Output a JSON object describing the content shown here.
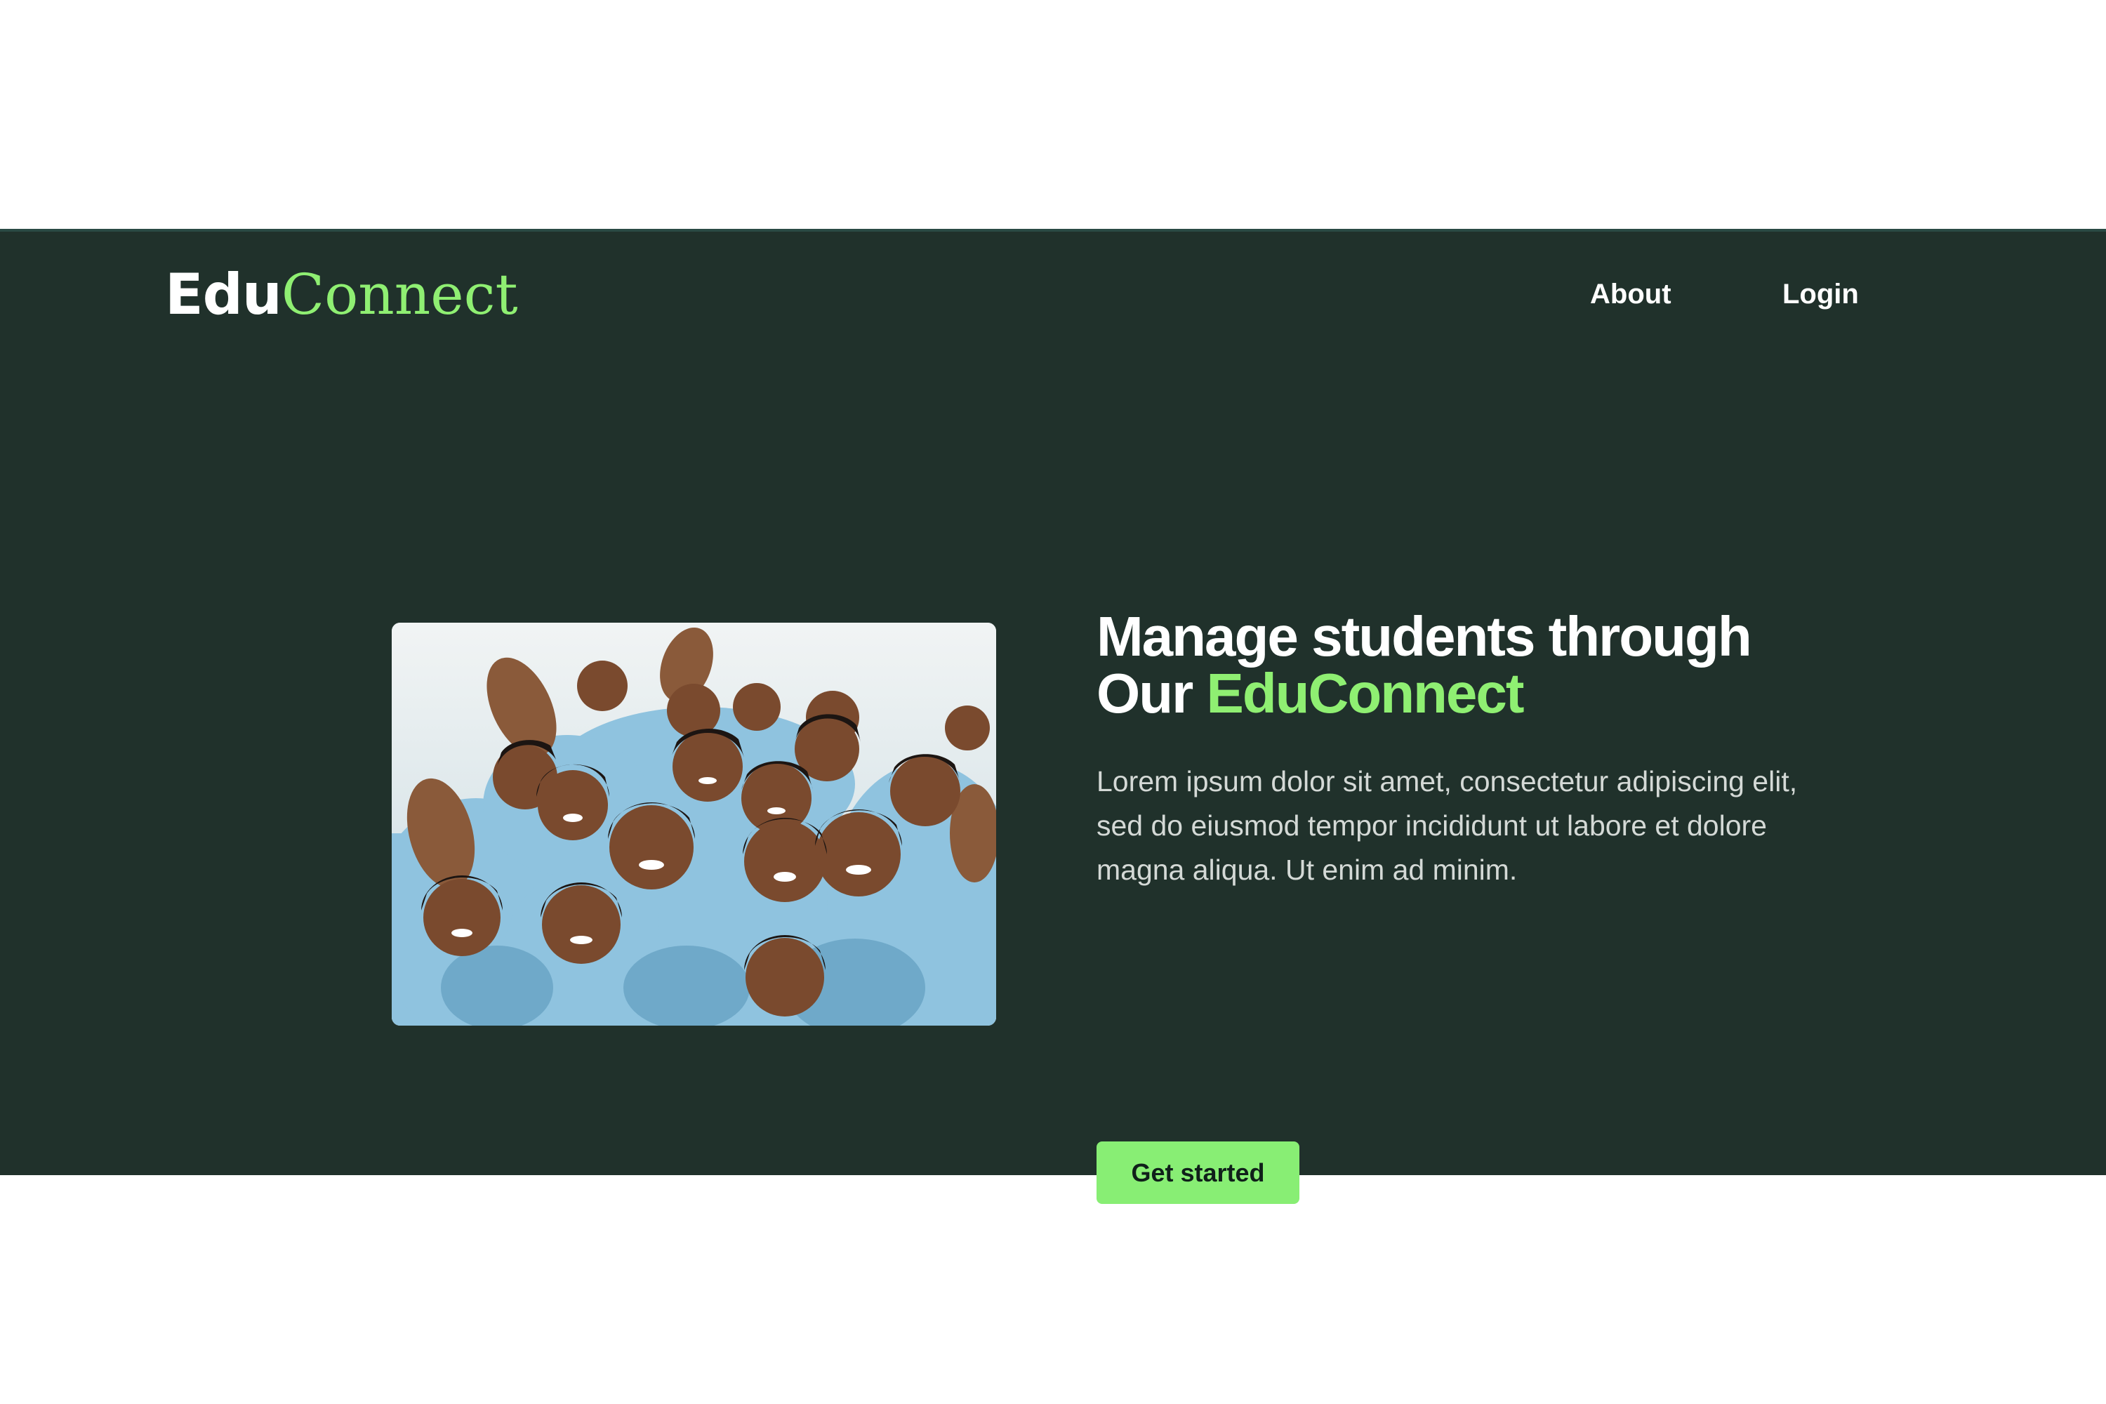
{
  "header": {
    "logo": {
      "part1": "Edu",
      "part2": "Connect"
    },
    "nav": [
      {
        "label": "About"
      },
      {
        "label": "Login"
      }
    ]
  },
  "hero": {
    "headline_line1": "Manage students through",
    "headline_line2_prefix": "Our ",
    "headline_line2_accent": "EduConnect",
    "body": "Lorem ipsum dolor sit amet, consectetur adipiscing elit, sed do eiusmod tempor incididunt ut labore et dolore magna aliqua. Ut enim ad minim.",
    "cta_label": "Get started",
    "image": "group-of-students-photo"
  },
  "colors": {
    "hero_background": "#20312b",
    "accent_green": "#8fef72",
    "button_green": "#88ee74",
    "page_background": "#ffffff"
  }
}
